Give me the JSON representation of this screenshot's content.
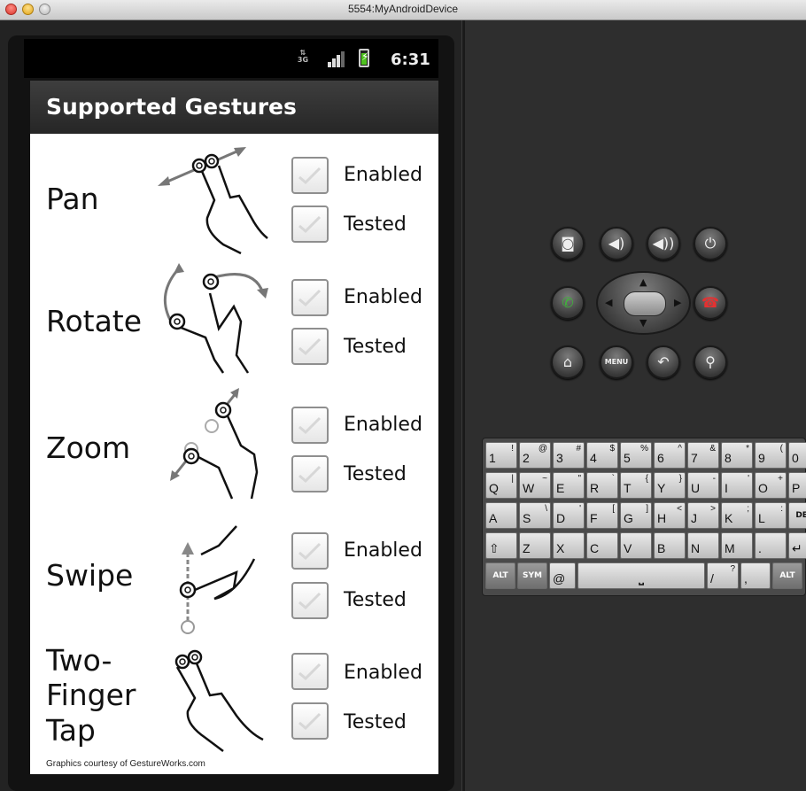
{
  "window": {
    "title": "5554:MyAndroidDevice"
  },
  "status_bar": {
    "network": "3G",
    "time": "6:31"
  },
  "app": {
    "title": "Supported Gestures"
  },
  "gestures": [
    {
      "name": "Pan",
      "enabled_label": "Enabled",
      "tested_label": "Tested",
      "enabled": true,
      "tested": true
    },
    {
      "name": "Rotate",
      "enabled_label": "Enabled",
      "tested_label": "Tested",
      "enabled": true,
      "tested": true
    },
    {
      "name": "Zoom",
      "enabled_label": "Enabled",
      "tested_label": "Tested",
      "enabled": true,
      "tested": true
    },
    {
      "name": "Swipe",
      "enabled_label": "Enabled",
      "tested_label": "Tested",
      "enabled": true,
      "tested": true
    },
    {
      "name": "Two-Finger Tap",
      "name_lines": [
        "Two-",
        "Finger",
        "Tap"
      ],
      "enabled_label": "Enabled",
      "tested_label": "Tested",
      "enabled": true,
      "tested": true
    }
  ],
  "credit": "Graphics courtesy of GestureWorks.com",
  "controls": {
    "buttons": [
      "camera-icon",
      "volume-down-icon",
      "volume-up-icon",
      "power-icon",
      "call-icon",
      "end-call-icon",
      "home-icon",
      "menu-button",
      "back-icon",
      "search-icon"
    ],
    "menu_label": "MENU"
  },
  "keyboard": {
    "rows": [
      [
        [
          "1",
          "!"
        ],
        [
          "2",
          "@"
        ],
        [
          "3",
          "#"
        ],
        [
          "4",
          "$"
        ],
        [
          "5",
          "%"
        ],
        [
          "6",
          "^"
        ],
        [
          "7",
          "&"
        ],
        [
          "8",
          "*"
        ],
        [
          "9",
          "("
        ],
        [
          "0",
          ")"
        ]
      ],
      [
        [
          "Q",
          "|"
        ],
        [
          "W",
          "~"
        ],
        [
          "E",
          "\""
        ],
        [
          "R",
          "`"
        ],
        [
          "T",
          "{"
        ],
        [
          "Y",
          "}"
        ],
        [
          "U",
          "-"
        ],
        [
          "I",
          "'"
        ],
        [
          "O",
          "+"
        ],
        [
          "P",
          "="
        ]
      ],
      [
        [
          "A",
          ""
        ],
        [
          "S",
          "\\"
        ],
        [
          "D",
          "'"
        ],
        [
          "F",
          "["
        ],
        [
          "G",
          "]"
        ],
        [
          "H",
          "<"
        ],
        [
          "J",
          ">"
        ],
        [
          "K",
          ";"
        ],
        [
          "L",
          ":"
        ],
        [
          "DEL",
          ""
        ]
      ],
      [
        [
          "⇧",
          ""
        ],
        [
          "Z",
          ""
        ],
        [
          "X",
          ""
        ],
        [
          "C",
          ""
        ],
        [
          "V",
          ""
        ],
        [
          "B",
          ""
        ],
        [
          "N",
          ""
        ],
        [
          "M",
          ""
        ],
        [
          ".",
          ""
        ],
        [
          "↵",
          ""
        ]
      ]
    ],
    "bottom": {
      "alt": "ALT",
      "sym": "SYM",
      "at": "@",
      "slash": "/",
      "question": "?",
      "comma": ","
    }
  }
}
